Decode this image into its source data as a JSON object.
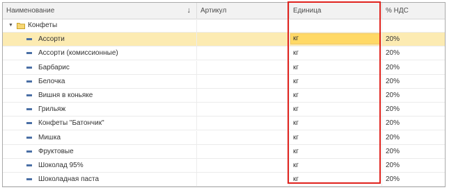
{
  "columns": {
    "name": "Наименование",
    "sort_indicator": "↓",
    "article": "Артикул",
    "unit": "Единица",
    "vat": "% НДС"
  },
  "group": {
    "label": "Конфеты",
    "expanded": true
  },
  "rows": [
    {
      "name": "Ассорти",
      "article": "",
      "unit": "кг",
      "vat": "20%",
      "selected": true
    },
    {
      "name": "Ассорти (комиссионные)",
      "article": "",
      "unit": "кг",
      "vat": "20%"
    },
    {
      "name": "Барбарис",
      "article": "",
      "unit": "кг",
      "vat": "20%"
    },
    {
      "name": "Белочка",
      "article": "",
      "unit": "кг",
      "vat": "20%"
    },
    {
      "name": "Вишня в коньяке",
      "article": "",
      "unit": "кг",
      "vat": "20%"
    },
    {
      "name": "Грильяж",
      "article": "",
      "unit": "кг",
      "vat": "20%"
    },
    {
      "name": "Конфеты \"Батончик\"",
      "article": "",
      "unit": "кг",
      "vat": "20%"
    },
    {
      "name": "Мишка",
      "article": "",
      "unit": "кг",
      "vat": "20%"
    },
    {
      "name": "Фруктовые",
      "article": "",
      "unit": "кг",
      "vat": "20%"
    },
    {
      "name": "Шоколад 95%",
      "article": "",
      "unit": "кг",
      "vat": "20%"
    },
    {
      "name": "Шоколадная паста",
      "article": "",
      "unit": "кг",
      "vat": "20%"
    }
  ],
  "colors": {
    "selected_row": "#fcebb2",
    "active_cell": "#ffd966",
    "annotation_border": "#e0211c",
    "item_icon": "#4a6fa5",
    "folder_icon": "#f0c64a"
  }
}
